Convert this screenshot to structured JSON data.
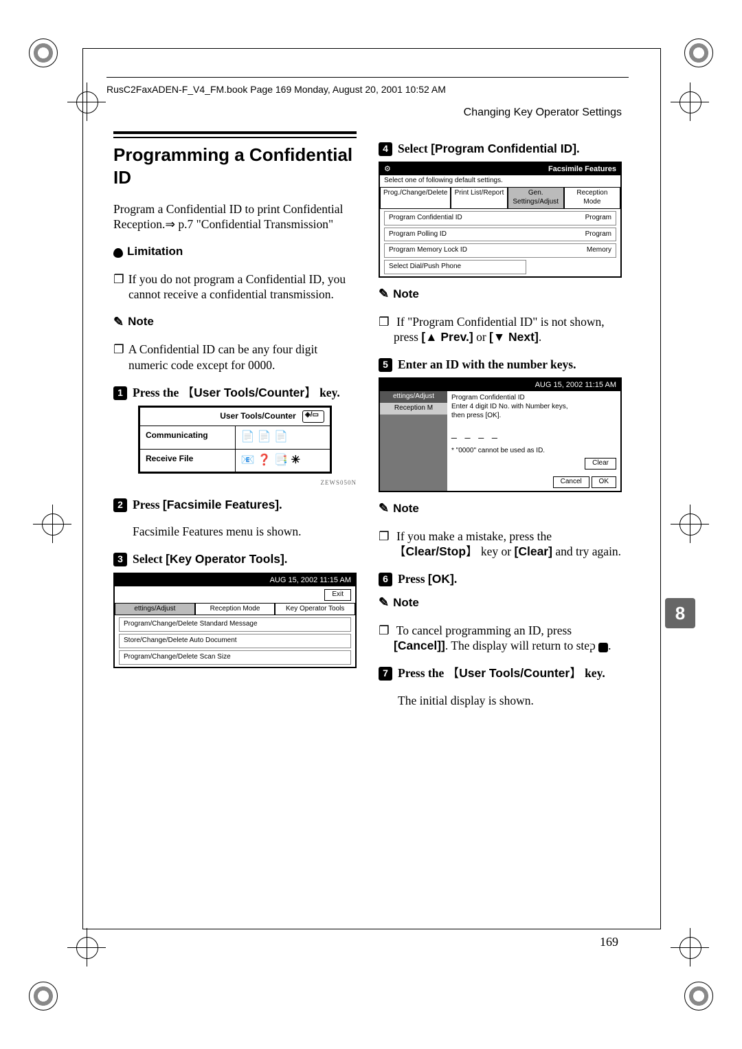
{
  "book_header": "RusC2FaxADEN-F_V4_FM.book  Page 169  Monday, August 20, 2001  10:52 AM",
  "running_head": "Changing Key Operator Settings",
  "section_title": "Programming a Confidential ID",
  "intro": "Program a Confidential ID to print Confidential Reception.",
  "intro_ref": " p.7 \"Confidential Transmission\"",
  "limitation_label": "Limitation",
  "limitation_text": "If you do not program a Confidential ID, you cannot receive a confidential transmission.",
  "note_label": "Note",
  "note1_text": "A Confidential ID can be any four digit numeric code except for 0000.",
  "step1_a": "Press the ",
  "step1_b": "User Tools/Counter",
  "step1_c": " key.",
  "panel_title": "User Tools/Counter",
  "panel_row1": "Communicating",
  "panel_row2": "Receive File",
  "panel_caption": "ZEWS050N",
  "step2_a": "Press ",
  "step2_b": "[Facsimile Features]",
  "step2_c": ".",
  "step2_body": "Facsimile Features menu is shown.",
  "step3_a": "Select ",
  "step3_b": "[Key Operator Tools]",
  "step3_c": ".",
  "shot3_time": "AUG 15, 2002  11:15 AM",
  "shot3_exit": "Exit",
  "shot3_tabs": [
    "ettings/Adjust",
    "Reception Mode",
    "Key Operator Tools"
  ],
  "shot3_rows": [
    "Program/Change/Delete Standard Message",
    "Store/Change/Delete Auto Document",
    "Program/Change/Delete Scan Size"
  ],
  "step4_a": "Select ",
  "step4_b": "[Program Confidential ID]",
  "step4_c": ".",
  "shot4_title": "Facsimile Features",
  "shot4_sub": "Select one of following default settings.",
  "shot4_tabs": [
    "Prog./Change/Delete",
    "Print List/Report",
    "Gen. Settings/Adjust",
    "Reception Mode"
  ],
  "shot4_rows": [
    {
      "l": "Program Confidential ID",
      "r": "Program"
    },
    {
      "l": "Program Polling ID",
      "r": "Program"
    },
    {
      "l": "Program Memory Lock ID",
      "r": "Memory"
    },
    {
      "l": "Select Dial/Push Phone",
      "r": ""
    }
  ],
  "note4_a": "If \"Program Confidential ID\" is not shown, press ",
  "note4_b1": "[▲ Prev.]",
  "note4_m": " or ",
  "note4_b2": "[▼ Next]",
  "note4_c": ".",
  "step5_text": "Enter an ID with the number keys.",
  "shot5_time": "AUG 15, 2002  11:15 AM",
  "shot5_tabs": [
    "ettings/Adjust",
    "Reception M"
  ],
  "shot5_head": "Program Confidential ID",
  "shot5_line1": "Enter 4 digit ID No. with Number keys,",
  "shot5_line2": "then press [OK].",
  "shot5_dash": "_ _ _ _",
  "shot5_warn": "* \"0000\" cannot be used as ID.",
  "shot5_clear": "Clear",
  "shot5_cancel": "Cancel",
  "shot5_ok": "OK",
  "note5_a": "If you make a mistake, press the ",
  "note5_b1": "Clear/Stop",
  "note5_m": " key or ",
  "note5_b2": "[Clear]",
  "note5_c": " and try again.",
  "step6_a": "Press ",
  "step6_b": "[OK]",
  "step6_c": ".",
  "note6_a": "To cancel programming an ID, press ",
  "note6_b": "[Cancel]]",
  "note6_c": ". The display will return to step ",
  "step7_a": "Press the ",
  "step7_b": "User Tools/Counter",
  "step7_c": " key.",
  "step7_body": "The initial display is shown.",
  "chapter_tab": "8",
  "page_number": "169"
}
